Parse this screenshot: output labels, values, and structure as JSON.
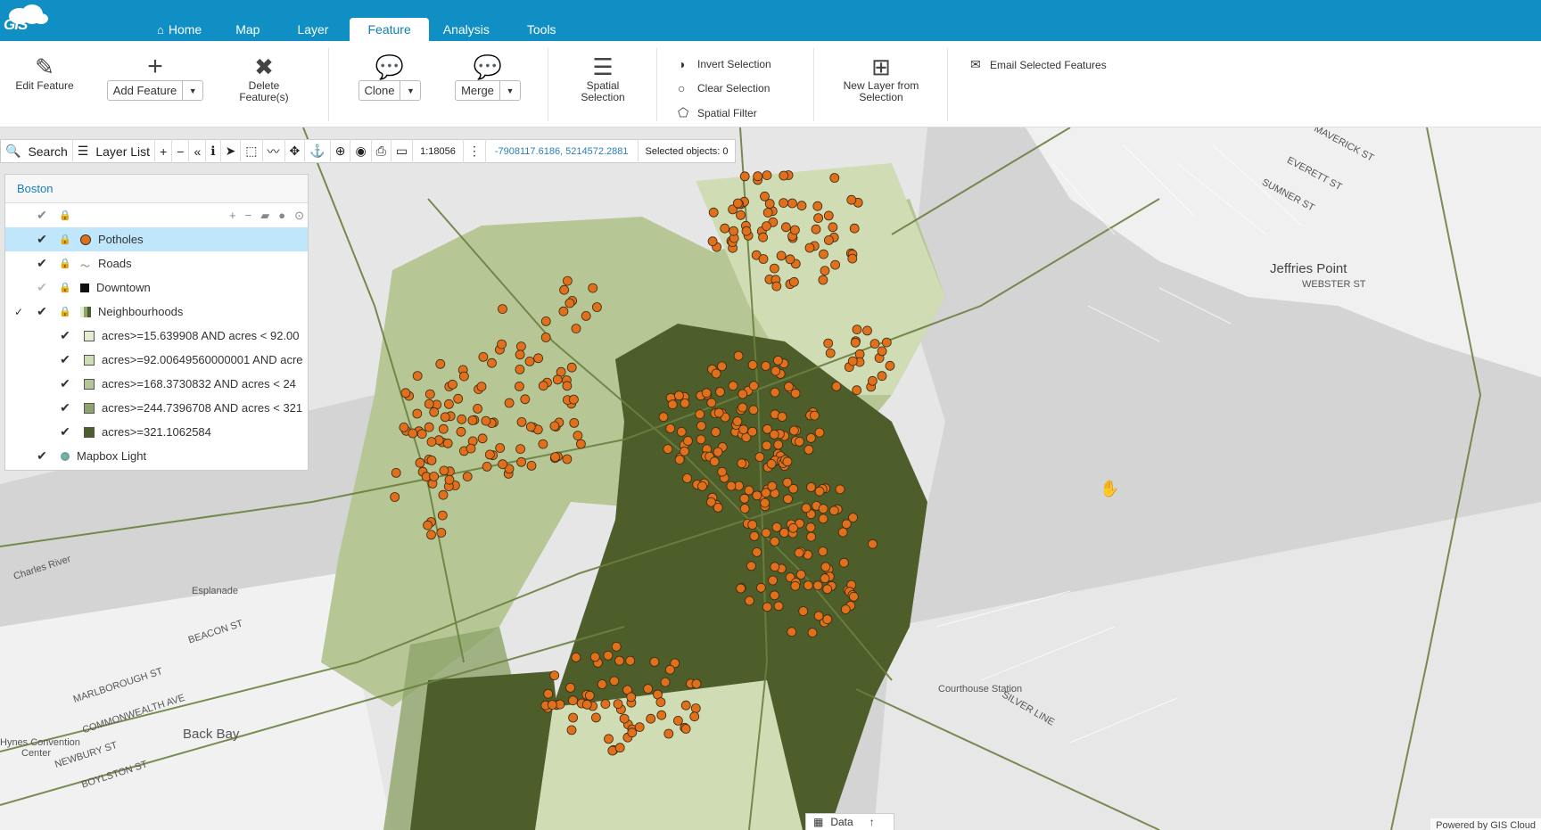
{
  "app": {
    "logo_text": "GIS"
  },
  "nav": {
    "tabs": [
      {
        "label": "Home",
        "icon": "home-icon",
        "active": false
      },
      {
        "label": "Map",
        "active": false
      },
      {
        "label": "Layer",
        "active": false
      },
      {
        "label": "Feature",
        "active": true
      },
      {
        "label": "Analysis",
        "active": false
      },
      {
        "label": "Tools",
        "active": false
      }
    ]
  },
  "ribbon": {
    "edit_feature": "Edit Feature",
    "add_feature": "Add Feature",
    "delete_feature_1": "Delete",
    "delete_feature_2": "Feature(s)",
    "clone": "Clone",
    "merge": "Merge",
    "spatial_selection_1": "Spatial",
    "spatial_selection_2": "Selection",
    "invert_selection": "Invert Selection",
    "clear_selection": "Clear Selection",
    "spatial_filter": "Spatial Filter",
    "new_layer_1": "New Layer from",
    "new_layer_2": "Selection",
    "email_selected": "Email Selected Features"
  },
  "maptools": {
    "search": "Search",
    "layer_list": "Layer List",
    "scale": "1:18056",
    "coordinates": "-7908117.6186, 5214572.2881",
    "selected_objects": "Selected objects: 0"
  },
  "layer_panel": {
    "title": "Boston",
    "layers": [
      {
        "name": "Potholes",
        "checked": true,
        "symbol": "point",
        "color": "#e0701c"
      },
      {
        "name": "Roads",
        "checked": true,
        "symbol": "line"
      },
      {
        "name": "Downtown",
        "checked": false,
        "symbol": "square",
        "color": "#111111"
      },
      {
        "name": "Neighbourhoods",
        "checked": true,
        "symbol": "grid",
        "expanded": true
      },
      {
        "name": "acres>=15.639908 AND acres < 92.00",
        "checked": true,
        "color": "#e3ecd0"
      },
      {
        "name": "acres>=92.00649560000001 AND acre",
        "checked": true,
        "color": "#cfdcb4"
      },
      {
        "name": "acres>=168.3730832 AND acres < 24",
        "checked": true,
        "color": "#b6c795"
      },
      {
        "name": "acres>=244.7396708 AND acres < 321",
        "checked": true,
        "color": "#8fa46a"
      },
      {
        "name": "acres>=321.1062584",
        "checked": true,
        "color": "#4d5e2a"
      },
      {
        "name": "Mapbox Light",
        "checked": true,
        "symbol": "globe"
      }
    ]
  },
  "map_labels": {
    "jeffries_point": "Jeffries Point",
    "back_bay": "Back Bay",
    "charles_river": "Charles River",
    "esplanade": "Esplanade",
    "courthouse_station": "Courthouse Station",
    "hynes": "Hynes Convention",
    "hynes2": "Center",
    "maverick": "MAVERICK ST",
    "everett": "EVERETT ST",
    "sumner": "SUMNER ST",
    "webster": "WEBSTER ST",
    "beacon": "BEACON ST",
    "boylston": "BOYLSTON ST",
    "newbury": "NEWBURY ST",
    "marlborough": "MARLBOROUGH ST",
    "commonwealth": "COMMONWEALTH AVE",
    "silver_line": "SILVER LINE"
  },
  "bottom": {
    "data_tab": "Data",
    "powered_by": "Powered by GIS Cloud"
  },
  "colors": {
    "nav_bg": "#0f8fc4",
    "accent": "#1a7fb8",
    "pothole": "#e0701c",
    "downtown": "#4d5e2a"
  }
}
